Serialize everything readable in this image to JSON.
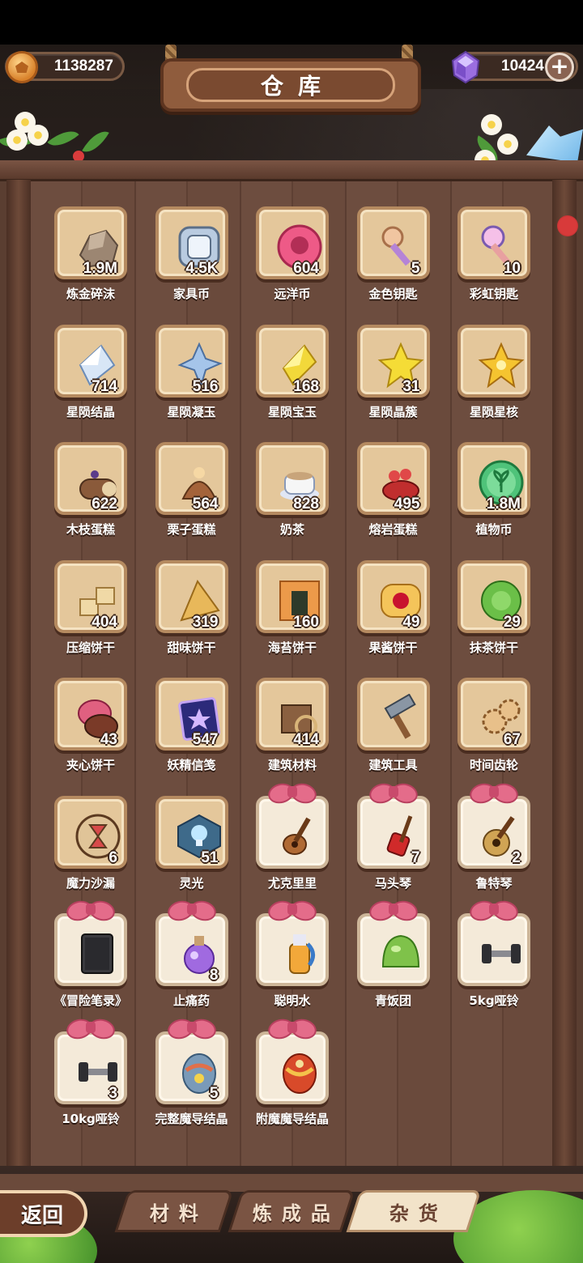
{
  "title": "仓库",
  "currency": {
    "gold": "1138287",
    "gems": "10424",
    "add_label": "+"
  },
  "items": [
    {
      "label": "炼金碎沫",
      "count": "1.9M",
      "icon": "stone-rubble-icon",
      "kind": "normal"
    },
    {
      "label": "家具币",
      "count": "4.5K",
      "icon": "silver-coin-icon",
      "kind": "normal"
    },
    {
      "label": "远洋币",
      "count": "604",
      "icon": "pink-coin-icon",
      "kind": "normal"
    },
    {
      "label": "金色钥匙",
      "count": "5",
      "icon": "golden-key-icon",
      "kind": "normal"
    },
    {
      "label": "彩虹钥匙",
      "count": "10",
      "icon": "rainbow-key-icon",
      "kind": "normal"
    },
    {
      "label": "星陨结晶",
      "count": "714",
      "icon": "white-crystal-icon",
      "kind": "normal"
    },
    {
      "label": "星陨凝玉",
      "count": "516",
      "icon": "blue-star-shard-icon",
      "kind": "normal"
    },
    {
      "label": "星陨宝玉",
      "count": "168",
      "icon": "yellow-crystal-icon",
      "kind": "normal"
    },
    {
      "label": "星陨晶簇",
      "count": "31",
      "icon": "yellow-star-icon",
      "kind": "normal"
    },
    {
      "label": "星陨星核",
      "count": "",
      "icon": "star-core-icon",
      "kind": "normal"
    },
    {
      "label": "木枝蛋糕",
      "count": "622",
      "icon": "log-cake-icon",
      "kind": "normal"
    },
    {
      "label": "栗子蛋糕",
      "count": "564",
      "icon": "chestnut-cake-icon",
      "kind": "normal"
    },
    {
      "label": "奶茶",
      "count": "828",
      "icon": "milk-tea-icon",
      "kind": "normal"
    },
    {
      "label": "熔岩蛋糕",
      "count": "495",
      "icon": "lava-cake-icon",
      "kind": "normal"
    },
    {
      "label": "植物币",
      "count": "1.8M",
      "icon": "plant-coin-icon",
      "kind": "normal"
    },
    {
      "label": "压缩饼干",
      "count": "404",
      "icon": "cube-cookie-icon",
      "kind": "normal"
    },
    {
      "label": "甜味饼干",
      "count": "319",
      "icon": "triangle-cracker-icon",
      "kind": "normal"
    },
    {
      "label": "海苔饼干",
      "count": "160",
      "icon": "seaweed-cracker-icon",
      "kind": "normal"
    },
    {
      "label": "果酱饼干",
      "count": "49",
      "icon": "jam-cookie-icon",
      "kind": "normal"
    },
    {
      "label": "抹茶饼干",
      "count": "29",
      "icon": "matcha-cookie-icon",
      "kind": "normal"
    },
    {
      "label": "夹心饼干",
      "count": "43",
      "icon": "macaron-icon",
      "kind": "normal"
    },
    {
      "label": "妖精信笺",
      "count": "547",
      "icon": "fairy-letter-icon",
      "kind": "normal"
    },
    {
      "label": "建筑材料",
      "count": "414",
      "icon": "building-material-icon",
      "kind": "normal"
    },
    {
      "label": "建筑工具",
      "count": "",
      "icon": "hammer-icon",
      "kind": "normal"
    },
    {
      "label": "时间齿轮",
      "count": "67",
      "icon": "gear-icon",
      "kind": "normal"
    },
    {
      "label": "魔力沙漏",
      "count": "6",
      "icon": "hourglass-icon",
      "kind": "normal"
    },
    {
      "label": "灵光",
      "count": "51",
      "icon": "lightbulb-icon",
      "kind": "normal"
    },
    {
      "label": "尤克里里",
      "count": "",
      "icon": "ukulele-icon",
      "kind": "gift"
    },
    {
      "label": "马头琴",
      "count": "7",
      "icon": "morin-khuur-icon",
      "kind": "gift"
    },
    {
      "label": "鲁特琴",
      "count": "2",
      "icon": "lute-icon",
      "kind": "gift"
    },
    {
      "label": "《冒险笔录》",
      "count": "",
      "icon": "book-icon",
      "kind": "gift"
    },
    {
      "label": "止痛药",
      "count": "8",
      "icon": "potion-icon",
      "kind": "gift"
    },
    {
      "label": "聪明水",
      "count": "",
      "icon": "bottle-icon",
      "kind": "gift"
    },
    {
      "label": "青饭团",
      "count": "",
      "icon": "green-riceball-icon",
      "kind": "gift"
    },
    {
      "label": "5kg哑铃",
      "count": "",
      "icon": "dumbbell-icon",
      "kind": "gift"
    },
    {
      "label": "10kg哑铃",
      "count": "3",
      "icon": "dumbbell-icon",
      "kind": "gift"
    },
    {
      "label": "完整魔导结晶",
      "count": "5",
      "icon": "magic-egg-icon",
      "kind": "gift"
    },
    {
      "label": "附魔魔导结晶",
      "count": "",
      "icon": "enchanted-egg-icon",
      "kind": "gift"
    }
  ],
  "tabs": [
    {
      "label": "材料",
      "active": false
    },
    {
      "label": "炼成品",
      "active": false
    },
    {
      "label": "杂货",
      "active": true
    }
  ],
  "back_label": "返回",
  "colors": {
    "board": "#5a3e31",
    "tile": "#e4c79b",
    "gift_tile": "#f4ead9",
    "ribbon": "#e46c8a",
    "active_tab": "#f2e3c9"
  }
}
